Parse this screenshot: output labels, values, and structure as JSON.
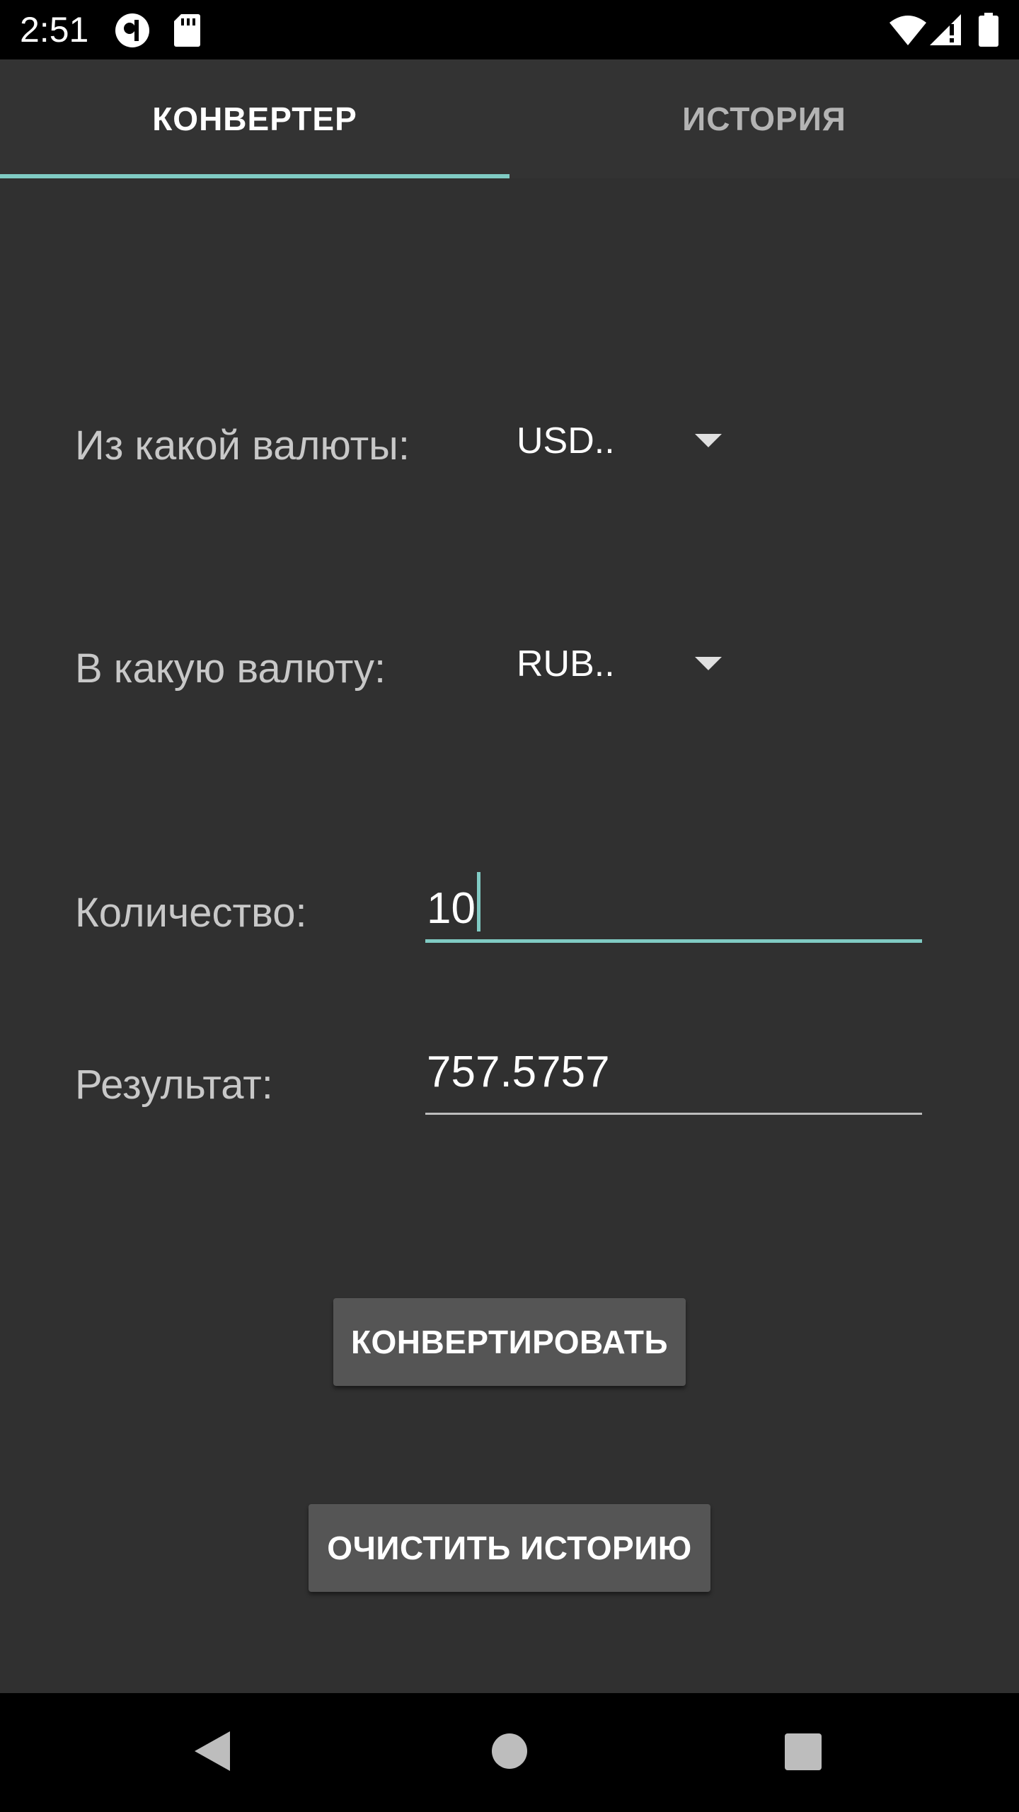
{
  "status_bar": {
    "time": "2:51"
  },
  "tabs": [
    {
      "label": "КОНВЕРТЕР",
      "selected": true
    },
    {
      "label": "ИСТОРИЯ",
      "selected": false
    }
  ],
  "form": {
    "from_label": "Из какой валюты:",
    "from_value": "USD..",
    "to_label": "В какую валюту:",
    "to_value": "RUB..",
    "amount_label": "Количество:",
    "amount_value": "10",
    "result_label": "Результат:",
    "result_value": "757.5757"
  },
  "buttons": {
    "convert": "КОНВЕРТИРОВАТЬ",
    "clear_history": "ОЧИСТИТЬ ИСТОРИЮ"
  },
  "colors": {
    "accent": "#80cbc4",
    "background": "#303030",
    "button": "#555555"
  }
}
